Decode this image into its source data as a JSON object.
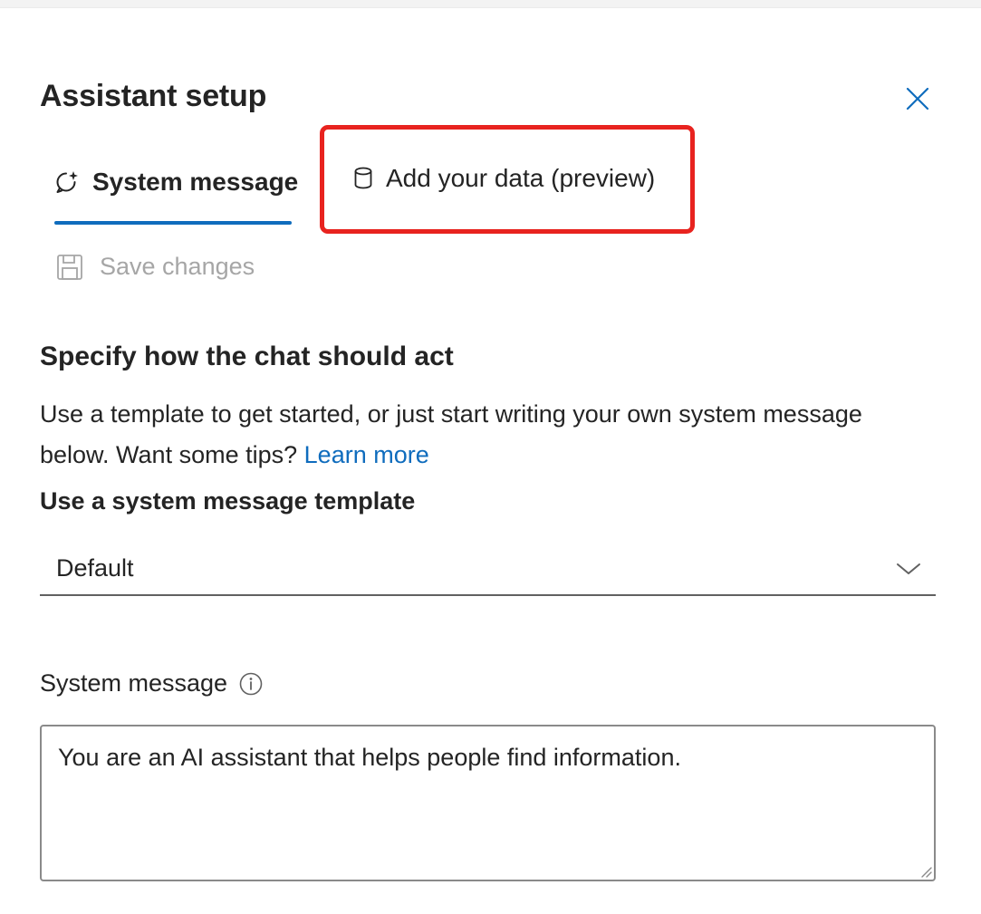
{
  "panel": {
    "title": "Assistant setup"
  },
  "tabs": [
    {
      "label": "System message",
      "icon": "chat-sparkle-icon",
      "selected": true
    },
    {
      "label": "Add your data (preview)",
      "icon": "database-icon",
      "selected": false
    }
  ],
  "toolbar": {
    "save_label": "Save changes",
    "save_icon": "save-icon",
    "save_disabled": true
  },
  "main": {
    "heading": "Specify how the chat should act",
    "description_text": "Use a template to get started, or just start writing your own system message below. Want some tips?",
    "learn_more": "Learn more",
    "template_label": "Use a system message template",
    "template_selected": "Default",
    "system_message_label": "System message",
    "system_message_value": "You are an AI assistant that helps people find information."
  },
  "colors": {
    "accent": "#0f6cbd",
    "highlight": "#e8231f",
    "disabled_text": "#a6a6a6"
  }
}
